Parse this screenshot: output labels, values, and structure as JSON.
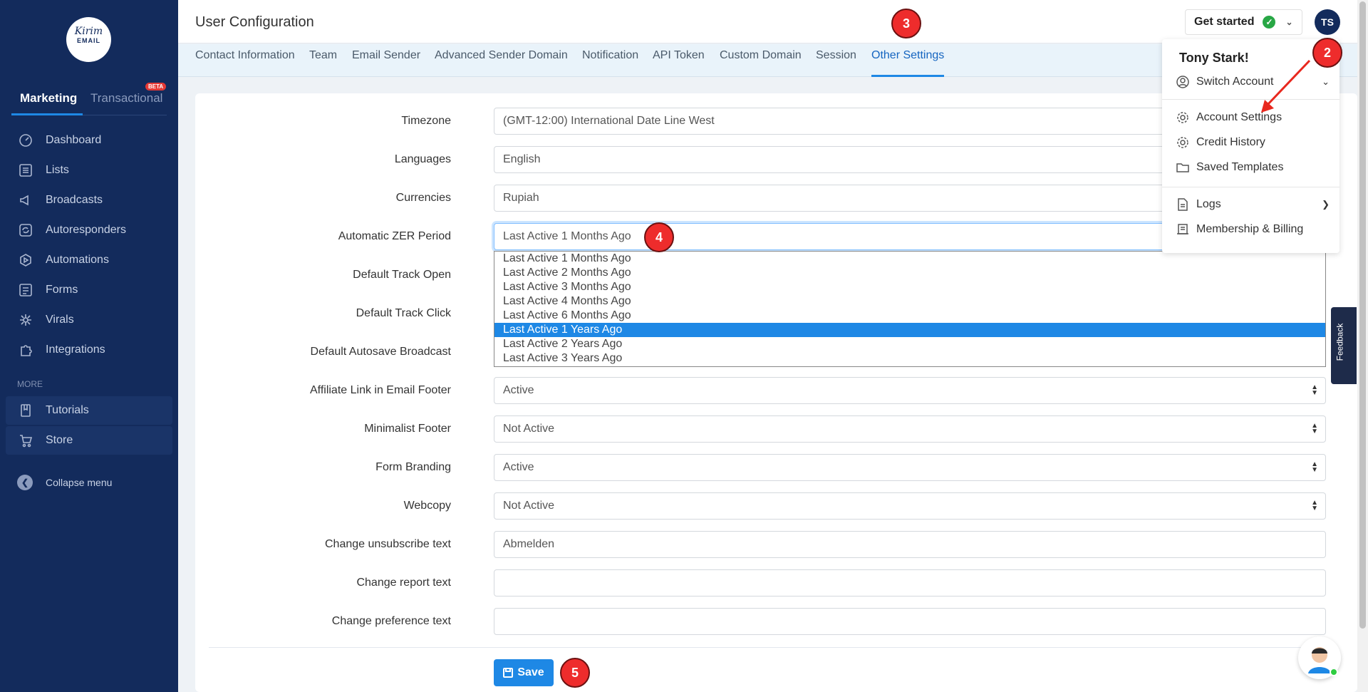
{
  "brand": {
    "logo_line1": "Kirim",
    "logo_line2": "EMAIL"
  },
  "sidebar": {
    "tab_marketing": "Marketing",
    "tab_transactional": "Transactional",
    "beta": "BETA",
    "items": [
      {
        "label": "Dashboard"
      },
      {
        "label": "Lists"
      },
      {
        "label": "Broadcasts"
      },
      {
        "label": "Autoresponders"
      },
      {
        "label": "Automations"
      },
      {
        "label": "Forms"
      },
      {
        "label": "Virals"
      },
      {
        "label": "Integrations"
      }
    ],
    "more": "MORE",
    "tutorials": "Tutorials",
    "store": "Store",
    "collapse": "Collapse menu"
  },
  "header": {
    "title": "User Configuration",
    "get_started": "Get started",
    "avatar": "TS"
  },
  "subnav": [
    "Contact Information",
    "Team",
    "Email Sender",
    "Advanced Sender Domain",
    "Notification",
    "API Token",
    "Custom Domain",
    "Session",
    "Other Settings"
  ],
  "form": {
    "timezone_label": "Timezone",
    "timezone_value": "(GMT-12:00) International Date Line West",
    "languages_label": "Languages",
    "languages_value": "English",
    "currencies_label": "Currencies",
    "currencies_value": "Rupiah",
    "zer_label": "Automatic ZER Period",
    "zer_value": "Last Active 1 Months Ago",
    "track_open_label": "Default Track Open",
    "track_click_label": "Default Track Click",
    "autosave_label": "Default Autosave Broadcast",
    "affiliate_label": "Affiliate Link in Email Footer",
    "affiliate_value": "Active",
    "minimalist_label": "Minimalist Footer",
    "minimalist_value": "Not Active",
    "branding_label": "Form Branding",
    "branding_value": "Active",
    "webcopy_label": "Webcopy",
    "webcopy_value": "Not Active",
    "unsub_label": "Change unsubscribe text",
    "unsub_value": "Abmelden",
    "report_label": "Change report text",
    "report_value": "",
    "pref_label": "Change preference text",
    "pref_value": "",
    "save": "Save"
  },
  "zer_options": [
    "Last Active 1 Months Ago",
    "Last Active 2 Months Ago",
    "Last Active 3 Months Ago",
    "Last Active 4 Months Ago",
    "Last Active 6 Months Ago",
    "Last Active 1 Years Ago",
    "Last Active 2 Years Ago",
    "Last Active 3 Years Ago"
  ],
  "zer_highlighted_index": 5,
  "account_menu": {
    "name": "Tony Stark!",
    "switch": "Switch Account",
    "settings": "Account Settings",
    "credit": "Credit History",
    "templates": "Saved Templates",
    "logs": "Logs",
    "membership": "Membership & Billing"
  },
  "feedback": "Feedback",
  "markers": {
    "m2": "2",
    "m3": "3",
    "m4": "4",
    "m5": "5"
  },
  "colors": {
    "sidebar": "#132b5c",
    "accent": "#1e88e5",
    "marker": "#ee2c2c"
  }
}
